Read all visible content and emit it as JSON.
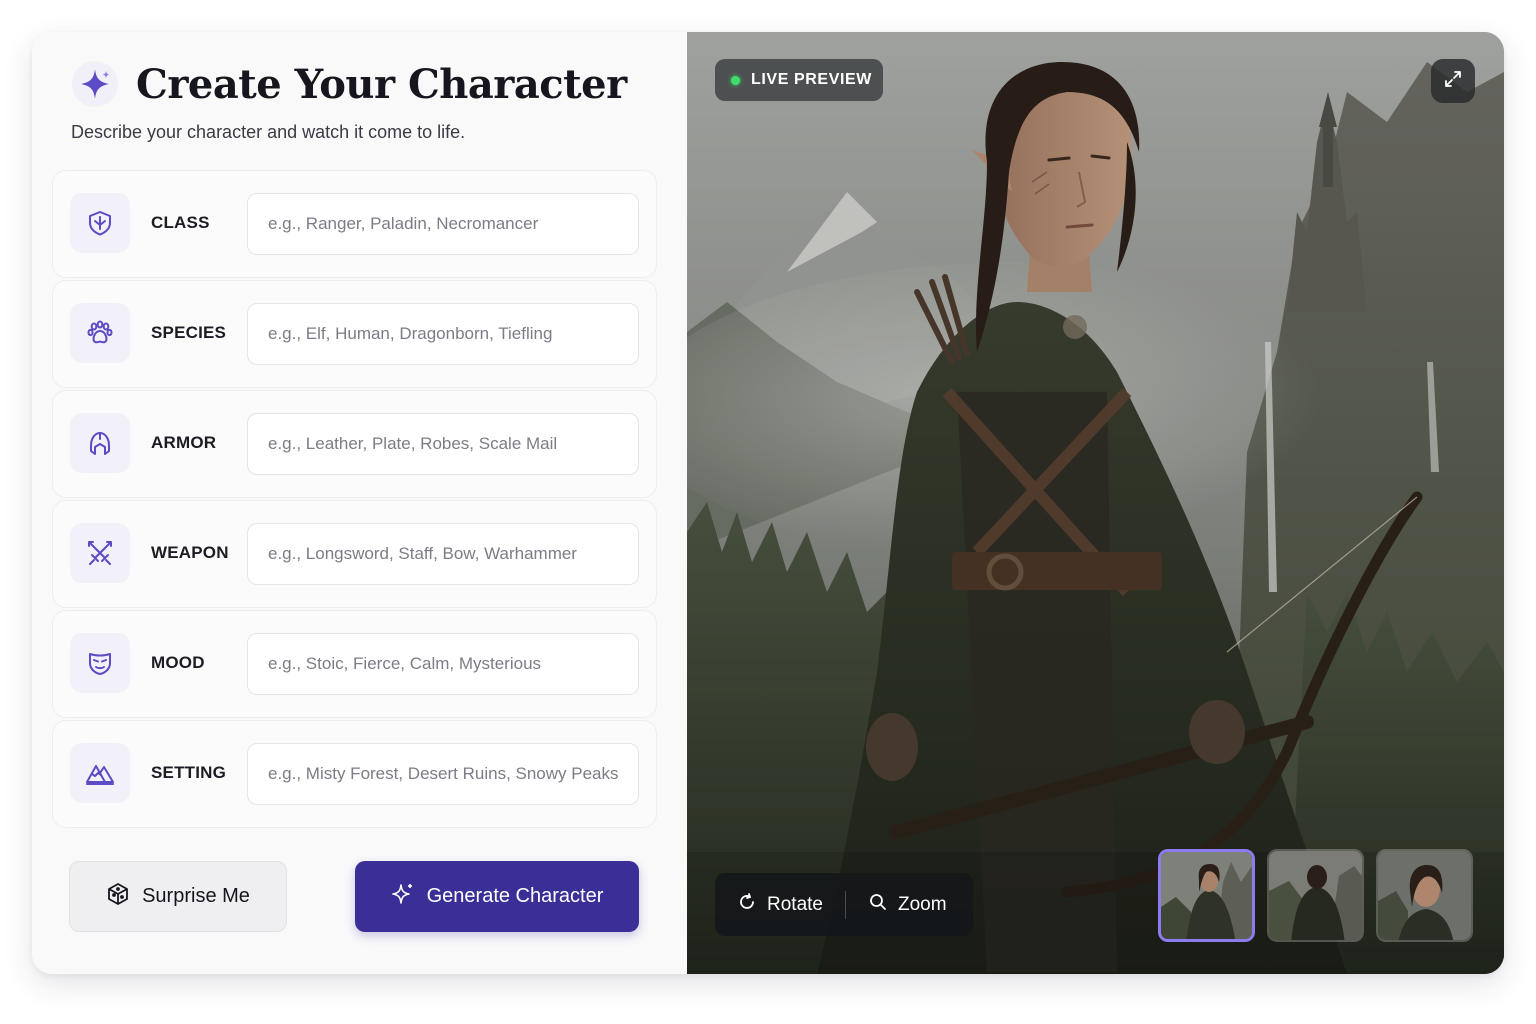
{
  "header": {
    "title": "Create Your Character",
    "subtitle": "Describe your character and watch it come to life."
  },
  "fields": [
    {
      "label": "CLASS",
      "placeholder": "e.g., Ranger, Paladin, Necromancer",
      "icon": "shield-icon"
    },
    {
      "label": "SPECIES",
      "placeholder": "e.g., Elf, Human, Dragonborn, Tiefling",
      "icon": "paw-icon"
    },
    {
      "label": "ARMOR",
      "placeholder": "e.g., Leather, Plate, Robes, Scale Mail",
      "icon": "helmet-icon"
    },
    {
      "label": "WEAPON",
      "placeholder": "e.g., Longsword, Staff, Bow, Warhammer",
      "icon": "crossed-swords-icon"
    },
    {
      "label": "MOOD",
      "placeholder": "e.g., Stoic, Fierce, Calm, Mysterious",
      "icon": "mask-icon"
    },
    {
      "label": "SETTING",
      "placeholder": "e.g., Misty Forest, Desert Ruins, Snowy Peaks",
      "icon": "mountain-icon"
    }
  ],
  "actions": {
    "surprise_label": "Surprise Me",
    "generate_label": "Generate Character"
  },
  "preview": {
    "badge": "LIVE PREVIEW",
    "rotate_label": "Rotate",
    "zoom_label": "Zoom",
    "selected_thumbnail": 1,
    "thumbnail_count": 3
  },
  "colors": {
    "accent": "#3a2f97",
    "icon_purple": "#5b4bc4",
    "live_dot": "#3ddc6b",
    "thumb_selected_border": "#8b7cf0"
  }
}
